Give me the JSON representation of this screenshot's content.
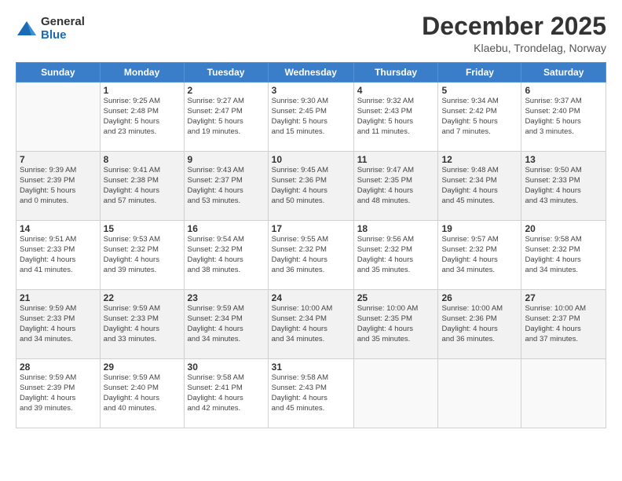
{
  "header": {
    "logo_general": "General",
    "logo_blue": "Blue",
    "month_title": "December 2025",
    "location": "Klaebu, Trondelag, Norway"
  },
  "weekdays": [
    "Sunday",
    "Monday",
    "Tuesday",
    "Wednesday",
    "Thursday",
    "Friday",
    "Saturday"
  ],
  "weeks": [
    [
      {
        "day": "",
        "info": ""
      },
      {
        "day": "1",
        "info": "Sunrise: 9:25 AM\nSunset: 2:48 PM\nDaylight: 5 hours\nand 23 minutes."
      },
      {
        "day": "2",
        "info": "Sunrise: 9:27 AM\nSunset: 2:47 PM\nDaylight: 5 hours\nand 19 minutes."
      },
      {
        "day": "3",
        "info": "Sunrise: 9:30 AM\nSunset: 2:45 PM\nDaylight: 5 hours\nand 15 minutes."
      },
      {
        "day": "4",
        "info": "Sunrise: 9:32 AM\nSunset: 2:43 PM\nDaylight: 5 hours\nand 11 minutes."
      },
      {
        "day": "5",
        "info": "Sunrise: 9:34 AM\nSunset: 2:42 PM\nDaylight: 5 hours\nand 7 minutes."
      },
      {
        "day": "6",
        "info": "Sunrise: 9:37 AM\nSunset: 2:40 PM\nDaylight: 5 hours\nand 3 minutes."
      }
    ],
    [
      {
        "day": "7",
        "info": "Sunrise: 9:39 AM\nSunset: 2:39 PM\nDaylight: 5 hours\nand 0 minutes."
      },
      {
        "day": "8",
        "info": "Sunrise: 9:41 AM\nSunset: 2:38 PM\nDaylight: 4 hours\nand 57 minutes."
      },
      {
        "day": "9",
        "info": "Sunrise: 9:43 AM\nSunset: 2:37 PM\nDaylight: 4 hours\nand 53 minutes."
      },
      {
        "day": "10",
        "info": "Sunrise: 9:45 AM\nSunset: 2:36 PM\nDaylight: 4 hours\nand 50 minutes."
      },
      {
        "day": "11",
        "info": "Sunrise: 9:47 AM\nSunset: 2:35 PM\nDaylight: 4 hours\nand 48 minutes."
      },
      {
        "day": "12",
        "info": "Sunrise: 9:48 AM\nSunset: 2:34 PM\nDaylight: 4 hours\nand 45 minutes."
      },
      {
        "day": "13",
        "info": "Sunrise: 9:50 AM\nSunset: 2:33 PM\nDaylight: 4 hours\nand 43 minutes."
      }
    ],
    [
      {
        "day": "14",
        "info": "Sunrise: 9:51 AM\nSunset: 2:33 PM\nDaylight: 4 hours\nand 41 minutes."
      },
      {
        "day": "15",
        "info": "Sunrise: 9:53 AM\nSunset: 2:32 PM\nDaylight: 4 hours\nand 39 minutes."
      },
      {
        "day": "16",
        "info": "Sunrise: 9:54 AM\nSunset: 2:32 PM\nDaylight: 4 hours\nand 38 minutes."
      },
      {
        "day": "17",
        "info": "Sunrise: 9:55 AM\nSunset: 2:32 PM\nDaylight: 4 hours\nand 36 minutes."
      },
      {
        "day": "18",
        "info": "Sunrise: 9:56 AM\nSunset: 2:32 PM\nDaylight: 4 hours\nand 35 minutes."
      },
      {
        "day": "19",
        "info": "Sunrise: 9:57 AM\nSunset: 2:32 PM\nDaylight: 4 hours\nand 34 minutes."
      },
      {
        "day": "20",
        "info": "Sunrise: 9:58 AM\nSunset: 2:32 PM\nDaylight: 4 hours\nand 34 minutes."
      }
    ],
    [
      {
        "day": "21",
        "info": "Sunrise: 9:59 AM\nSunset: 2:33 PM\nDaylight: 4 hours\nand 34 minutes."
      },
      {
        "day": "22",
        "info": "Sunrise: 9:59 AM\nSunset: 2:33 PM\nDaylight: 4 hours\nand 33 minutes."
      },
      {
        "day": "23",
        "info": "Sunrise: 9:59 AM\nSunset: 2:34 PM\nDaylight: 4 hours\nand 34 minutes."
      },
      {
        "day": "24",
        "info": "Sunrise: 10:00 AM\nSunset: 2:34 PM\nDaylight: 4 hours\nand 34 minutes."
      },
      {
        "day": "25",
        "info": "Sunrise: 10:00 AM\nSunset: 2:35 PM\nDaylight: 4 hours\nand 35 minutes."
      },
      {
        "day": "26",
        "info": "Sunrise: 10:00 AM\nSunset: 2:36 PM\nDaylight: 4 hours\nand 36 minutes."
      },
      {
        "day": "27",
        "info": "Sunrise: 10:00 AM\nSunset: 2:37 PM\nDaylight: 4 hours\nand 37 minutes."
      }
    ],
    [
      {
        "day": "28",
        "info": "Sunrise: 9:59 AM\nSunset: 2:39 PM\nDaylight: 4 hours\nand 39 minutes."
      },
      {
        "day": "29",
        "info": "Sunrise: 9:59 AM\nSunset: 2:40 PM\nDaylight: 4 hours\nand 40 minutes."
      },
      {
        "day": "30",
        "info": "Sunrise: 9:58 AM\nSunset: 2:41 PM\nDaylight: 4 hours\nand 42 minutes."
      },
      {
        "day": "31",
        "info": "Sunrise: 9:58 AM\nSunset: 2:43 PM\nDaylight: 4 hours\nand 45 minutes."
      },
      {
        "day": "",
        "info": ""
      },
      {
        "day": "",
        "info": ""
      },
      {
        "day": "",
        "info": ""
      }
    ]
  ]
}
